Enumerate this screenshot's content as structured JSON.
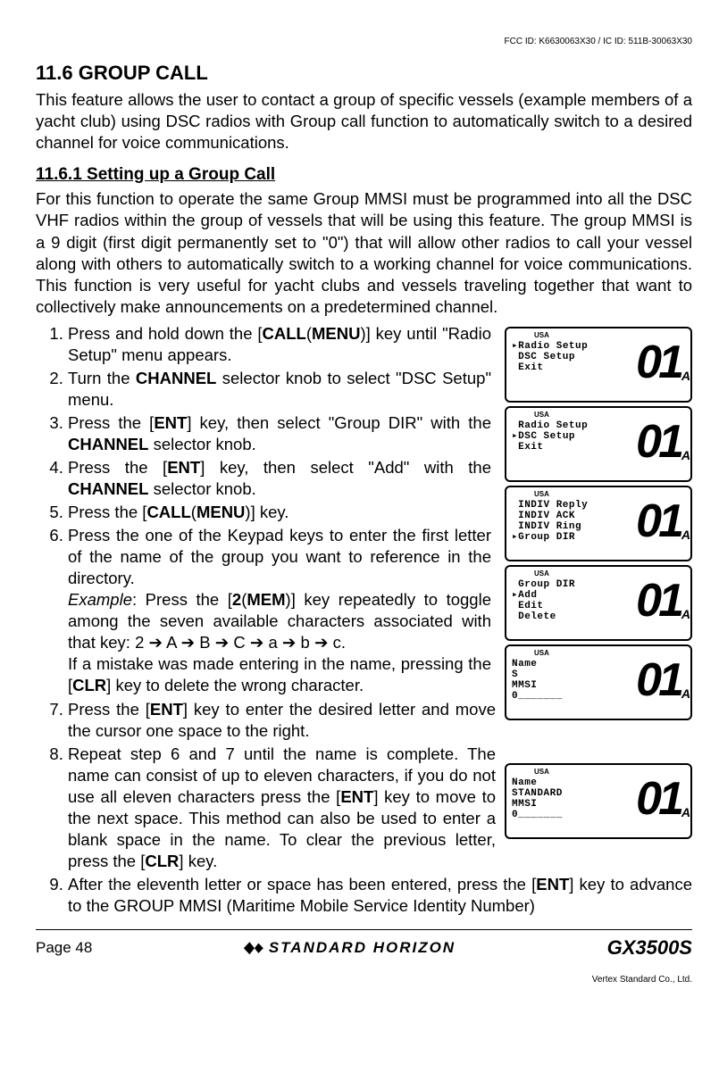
{
  "header": {
    "fcc": "FCC ID: K6630063X30 / IC ID: 511B-30063X30"
  },
  "section": {
    "title": "11.6  GROUP CALL",
    "intro": "This feature allows the user to contact a group of specific vessels (example members of a yacht club) using DSC radios with Group call function to automatically switch to a desired channel for voice communications.",
    "sub_title": "11.6.1 Setting up a Group Call",
    "sub_intro": "For this function to operate the same Group MMSI must be programmed into all the DSC VHF radios within the group of vessels that will be using this feature. The group MMSI is a 9 digit (first digit permanently set to \"0\") that will allow other radios to call your vessel along with others to automatically switch to a working channel for voice communications. This function is very useful for yacht clubs and vessels traveling together that want to collectively make announcements on a predetermined channel."
  },
  "steps": {
    "s1a": "Press and hold down the [",
    "s1b": "CALL",
    "s1c": "(",
    "s1d": "MENU",
    "s1e": ")] key until \"",
    "s1f": "Radio Setup",
    "s1g": "\" menu appears.",
    "s2a": "Turn the ",
    "s2b": "CHANNEL",
    "s2c": " selector knob to select \"",
    "s2d": "DSC Setup",
    "s2e": "\" menu.",
    "s3a": "Press the [",
    "s3b": "ENT",
    "s3c": "] key, then select \"",
    "s3d": "Group DIR",
    "s3e": "\" with the ",
    "s3f": "CHANNEL",
    "s3g": " selector knob.",
    "s4a": "Press the [",
    "s4b": "ENT",
    "s4c": "] key, then select \"",
    "s4d": "Add",
    "s4e": "\" with the ",
    "s4f": "CHANNEL",
    "s4g": " selector knob.",
    "s5a": "Press the [",
    "s5b": "CALL",
    "s5c": "(",
    "s5d": "MENU",
    "s5e": ")] key.",
    "s6a": "Press the one of the Keypad keys to enter the first letter of the name of the group you want to reference in the directory.",
    "s6b": "Example",
    "s6c": ": Press the [",
    "s6d": "2",
    "s6e": "(",
    "s6f": "MEM",
    "s6g": ")] key repeatedly to toggle among the seven available characters associated with that key: ",
    "s6h": "2 ➔ A ➔ B ➔ C ➔ a ➔ b ➔ c",
    "s6i": ".",
    "s6j": "If a mistake was made entering in the name, pressing the [",
    "s6k": "CLR",
    "s6l": "] key to delete the wrong character.",
    "s7a": "Press the [",
    "s7b": "ENT",
    "s7c": "] key to enter the desired letter and move the cursor one space to the right.",
    "s8a": "Repeat step 6 and 7 until the name is complete. The name can consist of up to eleven characters, if you do not use all eleven characters press the [",
    "s8b": "ENT",
    "s8c": "] key to move to the next space. This method can also be used to enter a blank space in the name. To clear the previous letter, press the [",
    "s8d": "CLR",
    "s8e": "] key.",
    "s9a": "After the eleventh letter or space has been entered, press the [",
    "s9b": "ENT",
    "s9c": "] key to advance to the GROUP MMSI (Maritime Mobile Service Identity Number)"
  },
  "lcd": {
    "usa": "USA",
    "big": "01",
    "a": "A",
    "d1": "▸Radio Setup\n DSC Setup\n Exit",
    "d2": " Radio Setup\n▸DSC Setup\n Exit",
    "d3": " INDIV Reply\n INDIV ACK\n INDIV Ring\n▸Group DIR",
    "d4": " Group DIR\n▸Add\n Edit\n Delete",
    "d5": "Name\nS\nMMSI\n0_______",
    "d6": "Name\nSTANDARD\nMMSI\n0_______"
  },
  "footer": {
    "page": "Page 48",
    "brand": "STANDARD HORIZON",
    "model": "GX3500S",
    "fine": "Vertex Standard Co., Ltd."
  }
}
